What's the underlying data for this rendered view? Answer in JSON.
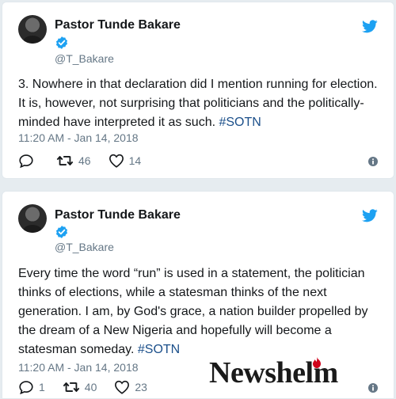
{
  "tweets": [
    {
      "author_name": "Pastor Tunde Bakare",
      "handle": "@T_Bakare",
      "text_before": "3. Nowhere in that declaration did I mention running for election.\nIt is, however, not surprising that politicians and the politically-\nminded have interpreted it as such. ",
      "hashtag": "#SOTN",
      "timestamp": "11:20 AM - Jan 14, 2018",
      "reply_count": "",
      "retweet_count": "46",
      "like_count": "14"
    },
    {
      "author_name": "Pastor Tunde Bakare",
      "handle": "@T_Bakare",
      "text_before": "Every time the word “run” is used in a statement, the politician\nthinks of elections, while a statesman thinks of the next\ngeneration. I am, by God's grace, a nation builder propelled by\nthe dream of a New Nigeria and hopefully will become a\nstatesman someday. ",
      "hashtag": "#SOTN",
      "timestamp": "11:20 AM - Jan 14, 2018",
      "reply_count": "1",
      "retweet_count": "40",
      "like_count": "23"
    }
  ],
  "watermark": {
    "text": "Newshelm"
  },
  "colors": {
    "twitter_blue": "#1da1f2",
    "hashtag": "#1b4f8a",
    "muted": "#657786",
    "watermark_accent": "#d0021b"
  },
  "icons": [
    "twitter-bird-icon",
    "verified-badge-icon",
    "reply-icon",
    "retweet-icon",
    "like-icon",
    "info-icon"
  ]
}
